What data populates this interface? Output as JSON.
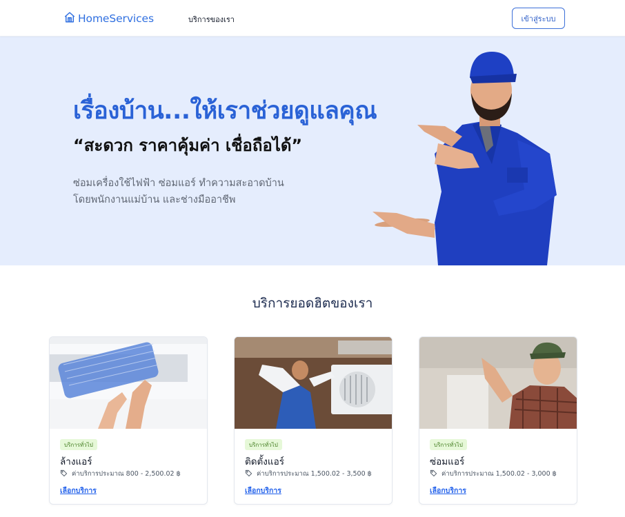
{
  "header": {
    "logo_text": "HomeServices",
    "nav_services": "บริการของเรา",
    "login_label": "เข้าสู่ระบบ"
  },
  "hero": {
    "title": "เรื่องบ้าน...ให้เราช่วยดูแลคุณ",
    "quote": "“สะดวก ราคาคุ้มค่า เชื่อถือได้”",
    "desc_line1": "ซ่อมเครื่องใช้ไฟฟ้า ซ่อมแอร์ ทำความสะอาดบ้าน",
    "desc_line2": "โดยพนักงานแม่บ้าน และช่างมืออาชีพ"
  },
  "section": {
    "title": "บริการยอดฮิตของเรา"
  },
  "cards": [
    {
      "badge": "บริการทั่วไป",
      "title": "ล้างแอร์",
      "price": "ค่าบริการประมาณ 800 - 2,500.02 ฿",
      "cta": "เลือกบริการ"
    },
    {
      "badge": "บริการทั่วไป",
      "title": "ติดตั้งแอร์",
      "price": "ค่าบริการประมาณ 1,500.02 - 3,500 ฿",
      "cta": "เลือกบริการ"
    },
    {
      "badge": "บริการทั่วไป",
      "title": "ซ่อมแอร์",
      "price": "ค่าบริการประมาณ 1,500.02 - 3,000 ฿",
      "cta": "เลือกบริการ"
    }
  ],
  "icons": {
    "logo": "home-icon",
    "price": "tag-icon"
  },
  "colors": {
    "brand": "#2f6fe0",
    "hero_bg": "#e5edfd",
    "badge_bg": "#e6f8d8",
    "link": "#2563eb"
  }
}
